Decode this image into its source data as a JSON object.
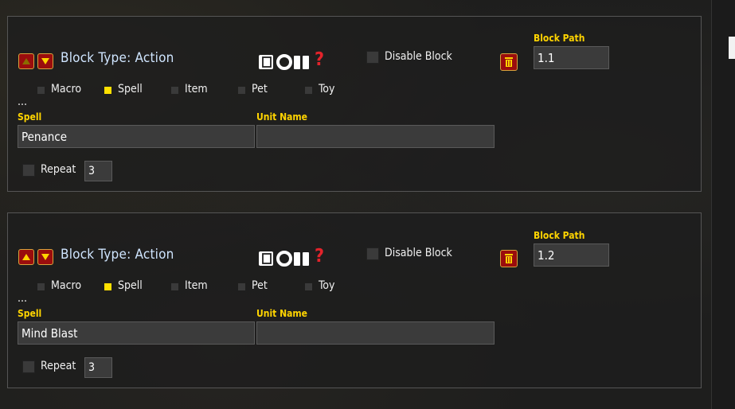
{
  "blocks": [
    {
      "title": "Block Type: Action",
      "disable_label": "Disable Block",
      "path_label": "Block Path",
      "path_value": "1.1",
      "types": [
        "Macro",
        "Spell",
        "Item",
        "Pet",
        "Toy"
      ],
      "selected_type": "Spell",
      "ellipsis": "...",
      "spell_label": "Spell",
      "spell_value": "Penance",
      "unit_label": "Unit Name",
      "unit_value": "",
      "repeat_label": "Repeat",
      "repeat_value": "3",
      "help_glyph": "?",
      "up_arrow_state": "disabled"
    },
    {
      "title": "Block Type: Action",
      "disable_label": "Disable Block",
      "path_label": "Block Path",
      "path_value": "1.2",
      "types": [
        "Macro",
        "Spell",
        "Item",
        "Pet",
        "Toy"
      ],
      "selected_type": "Spell",
      "ellipsis": "...",
      "spell_label": "Spell",
      "spell_value": "Mind Blast",
      "unit_label": "Unit Name",
      "unit_value": "",
      "repeat_label": "Repeat",
      "repeat_value": "3",
      "help_glyph": "?",
      "up_arrow_state": "enabled"
    }
  ],
  "icons": {
    "move_up": "arrow-up-icon",
    "move_down": "arrow-down-icon",
    "page": "page-icon",
    "ring": "ring-icon",
    "pause": "pause-icon",
    "help": "question-mark-icon",
    "trash": "trash-icon"
  },
  "colors": {
    "accent_yellow": "#ffd400",
    "title_blue": "#cfe5ff",
    "button_red": "#9a0d0d",
    "button_border": "#d8a23c"
  }
}
